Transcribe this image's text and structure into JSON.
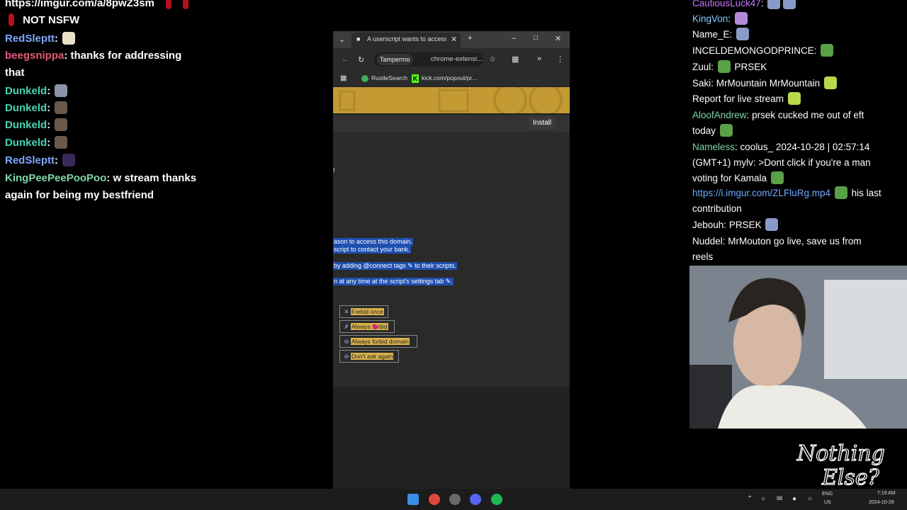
{
  "left_chat": [
    {
      "user": "",
      "text": "https://imgur.com/a/8pwZ3sm",
      "color": "#ffffff"
    },
    {
      "user": "",
      "text": "NOT NSFW",
      "color": "#ffffff"
    },
    {
      "user": "RedSleptt",
      "text": "",
      "color": "#7fa6ff"
    },
    {
      "user": "beegsnippa",
      "text": "thanks for addressing",
      "color": "#e05a7a"
    },
    {
      "user": "",
      "text": "that",
      "color": "#ffffff"
    },
    {
      "user": "Dunkeld",
      "text": "",
      "color": "#46d4b4"
    },
    {
      "user": "Dunkeld",
      "text": "",
      "color": "#46d4b4"
    },
    {
      "user": "Dunkeld",
      "text": "",
      "color": "#46d4b4"
    },
    {
      "user": "Dunkeld",
      "text": "",
      "color": "#46d4b4"
    },
    {
      "user": "RedSleptt",
      "text": "",
      "color": "#7fa6ff"
    },
    {
      "user": "KingPeePeePooPoo",
      "text": "w stream thanks",
      "color": "#7fd6a8"
    },
    {
      "user": "",
      "text": "again for being my bestfriend",
      "color": "#ffffff"
    }
  ],
  "browser": {
    "tab_title": "A userscript wants to access a c",
    "omnibox_chip": "Tampermo",
    "omnibox_url": "chrome-extensi...",
    "bookmarks": [
      "RustleSearch",
      "kick.com/popout/pr..."
    ],
    "install_label": "Install",
    "page_fragment": "t",
    "selected_lines": [
      "ason to access this domain.",
      "script to contact your bank.",
      "by adding @connect tags ✎ to their scripts.",
      "n at any time at the script's settings tab ✎."
    ],
    "options": [
      {
        "label": "Forbid once",
        "icon": "✕"
      },
      {
        "label": "Always forbid",
        "icon": "✗"
      },
      {
        "label": "Always forbid domain",
        "icon": "⊖"
      },
      {
        "label": "Don't ask again",
        "icon": "⊖"
      }
    ]
  },
  "right_chat": [
    {
      "user": "CautiousLuck47",
      "text": "",
      "color": "#c878ff"
    },
    {
      "user": "KingVon",
      "text": "",
      "color": "#7fd0ff"
    },
    {
      "user": "Name_E",
      "text": "",
      "color": "#ffffff"
    },
    {
      "user": "INCELDEMONGODPRINCE",
      "text": "",
      "color": "#ffffff"
    },
    {
      "user": "Zuul",
      "text": "PRSEK",
      "color": "#ffffff"
    },
    {
      "user": "Saki",
      "text": "MrMountain  MrMountain",
      "color": "#ffffff"
    },
    {
      "user": "",
      "text": "Report for live stream",
      "color": "#ffffff"
    },
    {
      "user": "AloofAndrew",
      "text": "prsek cucked me out of eft",
      "color": "#7fd6a8"
    },
    {
      "user": "",
      "text": "today",
      "color": "#ffffff"
    },
    {
      "user": "Nameless",
      "text": "coolus_ 2024-10-28 | 02:57:14",
      "color": "#7fd6a8"
    },
    {
      "user": "",
      "text": "(GMT+1) mylv: >Dont click if you're a man",
      "color": "#ffffff"
    },
    {
      "user": "",
      "text": "voting for Kamala",
      "color": "#ffffff"
    },
    {
      "user": "",
      "text": "https://i.imgur.com/ZLFluRg.mp4",
      "extra": "his last",
      "color": "#6fa8ff"
    },
    {
      "user": "",
      "text": "contribution",
      "color": "#ffffff"
    },
    {
      "user": "Jebouh",
      "text": "PRSEK",
      "color": "#ffffff"
    },
    {
      "user": "Nuddel",
      "text": "MrMouton go live, save us from",
      "color": "#ffffff"
    },
    {
      "user": "",
      "text": "reels",
      "color": "#ffffff"
    }
  ],
  "taskbar": {
    "lang": "ENG",
    "region": "US",
    "time": "7:19 AM",
    "date": "2024-10-28"
  },
  "watermark": {
    "line1": "Nothing",
    "line2": "Else?"
  }
}
